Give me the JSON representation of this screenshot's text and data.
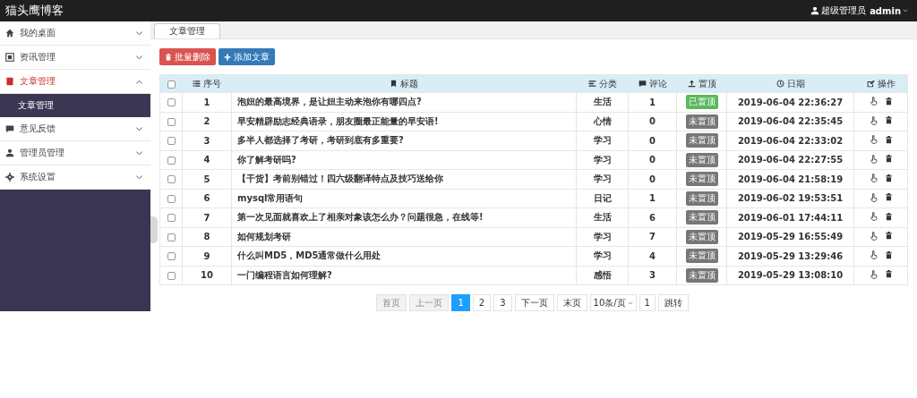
{
  "header": {
    "brand": "猫头鹰博客",
    "role": "超级管理员",
    "user": "admin"
  },
  "sidebar": {
    "items": [
      {
        "label": "我的桌面",
        "expanded": false,
        "active": false
      },
      {
        "label": "资讯管理",
        "expanded": false,
        "active": false
      },
      {
        "label": "文章管理",
        "expanded": true,
        "active": true,
        "children": [
          {
            "label": "文章管理",
            "selected": true
          }
        ]
      },
      {
        "label": "意见反馈",
        "expanded": false,
        "active": false
      },
      {
        "label": "管理员管理",
        "expanded": false,
        "active": false
      },
      {
        "label": "系统设置",
        "expanded": false,
        "active": false
      }
    ]
  },
  "tabs": [
    {
      "label": "文章管理",
      "selected": true
    }
  ],
  "toolbar": [
    {
      "label": "批量删除",
      "kind": "danger"
    },
    {
      "label": "添加文章",
      "kind": "primary"
    }
  ],
  "table": {
    "all_checked": false,
    "columns": [
      {
        "label": "序号"
      },
      {
        "label": "标题"
      },
      {
        "label": "分类"
      },
      {
        "label": "评论"
      },
      {
        "label": "置顶"
      },
      {
        "label": "日期"
      },
      {
        "label": "操作"
      }
    ],
    "rows": [
      {
        "checked": false,
        "no": "1",
        "title": "泡妞的最高境界，是让妞主动来泡你有哪四点?",
        "category": "生活",
        "comments": "1",
        "pinned": true,
        "pin_label": "已置顶",
        "date": "2019-06-04 22:36:27"
      },
      {
        "checked": false,
        "no": "2",
        "title": "早安精辟励志经典语录，朋友圈最正能量的早安语!",
        "category": "心情",
        "comments": "0",
        "pinned": false,
        "pin_label": "未置顶",
        "date": "2019-06-04 22:35:45"
      },
      {
        "checked": false,
        "no": "3",
        "title": "多半人都选择了考研，考研到底有多重要?",
        "category": "学习",
        "comments": "0",
        "pinned": false,
        "pin_label": "未置顶",
        "date": "2019-06-04 22:33:02"
      },
      {
        "checked": false,
        "no": "4",
        "title": "你了解考研吗?",
        "category": "学习",
        "comments": "0",
        "pinned": false,
        "pin_label": "未置顶",
        "date": "2019-06-04 22:27:55"
      },
      {
        "checked": false,
        "no": "5",
        "title": "【干货】考前别错过！四六级翻译特点及技巧送给你",
        "category": "学习",
        "comments": "0",
        "pinned": false,
        "pin_label": "未置顶",
        "date": "2019-06-04 21:58:19"
      },
      {
        "checked": false,
        "no": "6",
        "title": "mysql常用语句",
        "category": "日记",
        "comments": "1",
        "pinned": false,
        "pin_label": "未置顶",
        "date": "2019-06-02 19:53:51"
      },
      {
        "checked": false,
        "no": "7",
        "title": "第一次见面就喜欢上了相亲对象该怎么办？问题很急，在线等!",
        "category": "生活",
        "comments": "6",
        "pinned": false,
        "pin_label": "未置顶",
        "date": "2019-06-01 17:44:11"
      },
      {
        "checked": false,
        "no": "8",
        "title": "如何规划考研",
        "category": "学习",
        "comments": "7",
        "pinned": false,
        "pin_label": "未置顶",
        "date": "2019-05-29 16:55:49"
      },
      {
        "checked": false,
        "no": "9",
        "title": "什么叫MD5，MD5通常做什么用处",
        "category": "学习",
        "comments": "4",
        "pinned": false,
        "pin_label": "未置顶",
        "date": "2019-05-29 13:29:46"
      },
      {
        "checked": false,
        "no": "10",
        "title": "一门编程语言如何理解?",
        "category": "感悟",
        "comments": "3",
        "pinned": false,
        "pin_label": "未置顶",
        "date": "2019-05-29 13:08:10"
      }
    ]
  },
  "pagination": {
    "items": [
      {
        "label": "首页",
        "kind": "link",
        "disabled": true
      },
      {
        "label": "上一页",
        "kind": "link",
        "disabled": true
      },
      {
        "label": "1",
        "kind": "page",
        "selected": true
      },
      {
        "label": "2",
        "kind": "page",
        "selected": false
      },
      {
        "label": "3",
        "kind": "page",
        "selected": false
      },
      {
        "label": "下一页",
        "kind": "link",
        "disabled": false
      },
      {
        "label": "末页",
        "kind": "link",
        "disabled": false
      },
      {
        "label": "10条/页",
        "kind": "select"
      },
      {
        "label": "1",
        "kind": "input"
      },
      {
        "label": "跳转",
        "kind": "link",
        "disabled": false
      }
    ]
  }
}
